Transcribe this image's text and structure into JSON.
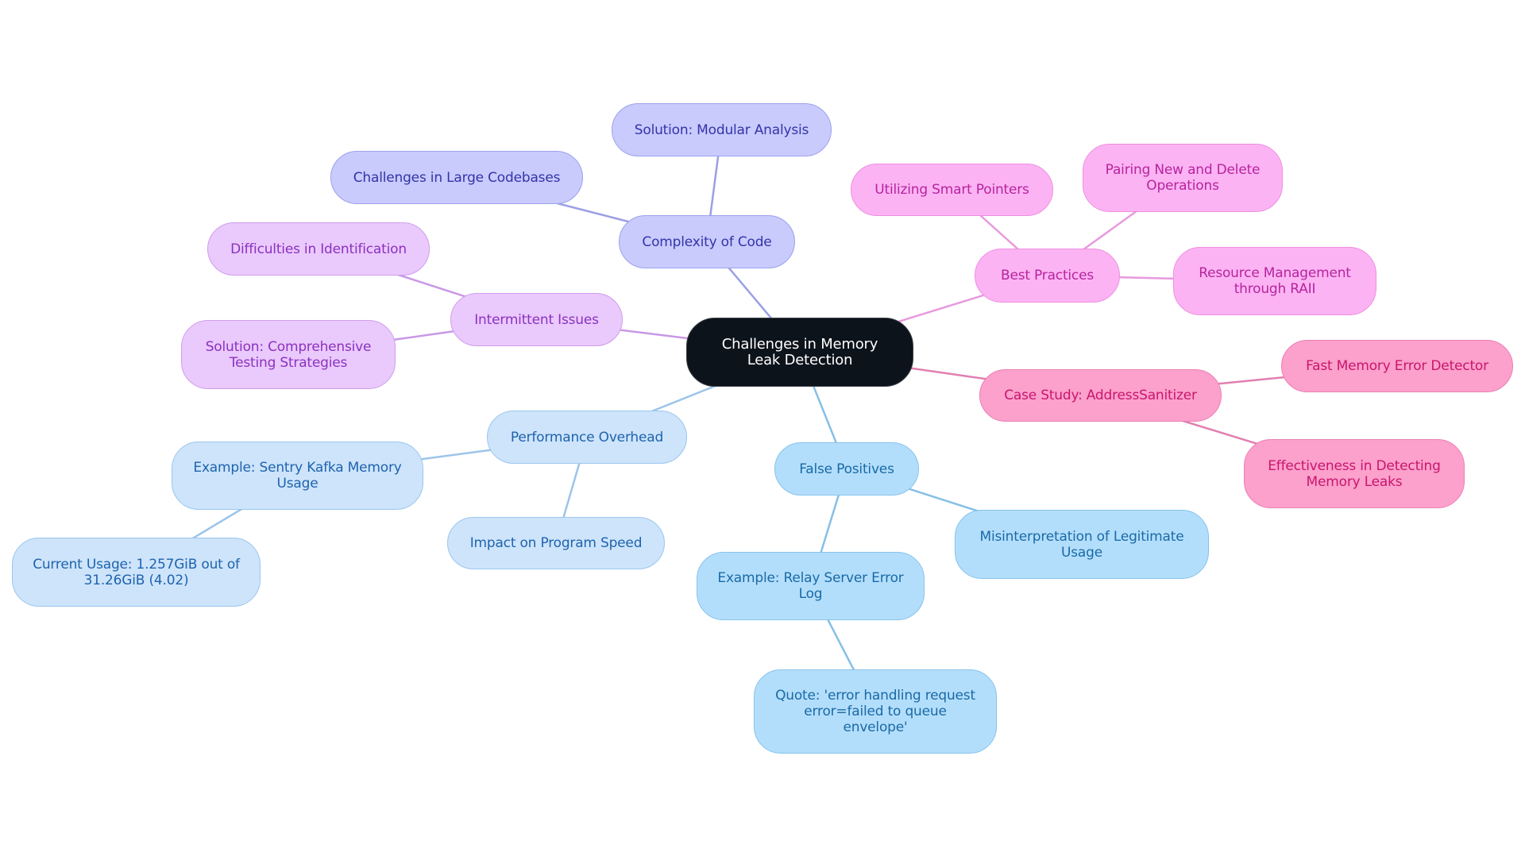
{
  "diagram": {
    "type": "mind-map",
    "root": {
      "id": "root",
      "label": "Challenges in Memory Leak Detection",
      "colors": {
        "fill": "#0d131b",
        "border": "#3b3f45",
        "text": "#ffffff"
      }
    },
    "branches": [
      {
        "id": "complexity",
        "label": "Complexity of Code",
        "colors": {
          "fill": "#c8cbfc",
          "border": "#9da2ec",
          "text": "#3434a8",
          "edge": "#9a9fe4"
        },
        "children": [
          {
            "id": "large-codebases",
            "label": "Challenges in Large Codebases"
          },
          {
            "id": "modular-analysis",
            "label": "Solution: Modular Analysis"
          }
        ]
      },
      {
        "id": "intermittent",
        "label": "Intermittent Issues",
        "colors": {
          "fill": "#eac9fc",
          "border": "#cf9eec",
          "text": "#8a32bf",
          "edge": "#c998e6"
        },
        "children": [
          {
            "id": "difficulties",
            "label": "Difficulties in Identification"
          },
          {
            "id": "testing",
            "label": "Solution: Comprehensive Testing Strategies"
          }
        ]
      },
      {
        "id": "best-practices",
        "label": "Best Practices",
        "colors": {
          "fill": "#fcb3f3",
          "border": "#ee8fe1",
          "text": "#b6249e",
          "edge": "#e79ade"
        },
        "children": [
          {
            "id": "smart-pointers",
            "label": "Utilizing Smart Pointers"
          },
          {
            "id": "new-delete",
            "label": "Pairing New and Delete Operations"
          },
          {
            "id": "raii",
            "label": "Resource Management through RAII"
          }
        ]
      },
      {
        "id": "case-study",
        "label": "Case Study: AddressSanitizer",
        "colors": {
          "fill": "#fca0cc",
          "border": "#ec80b5",
          "text": "#c8166d",
          "edge": "#e17fb0"
        },
        "children": [
          {
            "id": "fast-detector",
            "label": "Fast Memory Error Detector"
          },
          {
            "id": "effectiveness",
            "label": "Effectiveness in Detecting Memory Leaks"
          }
        ]
      },
      {
        "id": "performance",
        "label": "Performance Overhead",
        "colors": {
          "fill": "#cde4fb",
          "border": "#9cc6ee",
          "text": "#1f63ad",
          "edge": "#9cc4ea"
        },
        "children": [
          {
            "id": "sentry-kafka",
            "label": "Example: Sentry Kafka Memory Usage",
            "children": [
              {
                "id": "current-usage",
                "label": "Current Usage: 1.257GiB out of 31.26GiB (4.02)"
              }
            ]
          },
          {
            "id": "program-speed",
            "label": "Impact on Program Speed"
          }
        ]
      },
      {
        "id": "false-positives",
        "label": "False Positives",
        "colors": {
          "fill": "#b3defb",
          "border": "#86c3ec",
          "text": "#1a6aa6",
          "edge": "#86c0e6"
        },
        "children": [
          {
            "id": "relay-log",
            "label": "Example: Relay Server Error Log",
            "children": [
              {
                "id": "quote",
                "label": "Quote: 'error handling request error=failed to queue envelope'"
              }
            ]
          },
          {
            "id": "misinterpretation",
            "label": "Misinterpretation of Legitimate Usage"
          }
        ]
      }
    ]
  }
}
